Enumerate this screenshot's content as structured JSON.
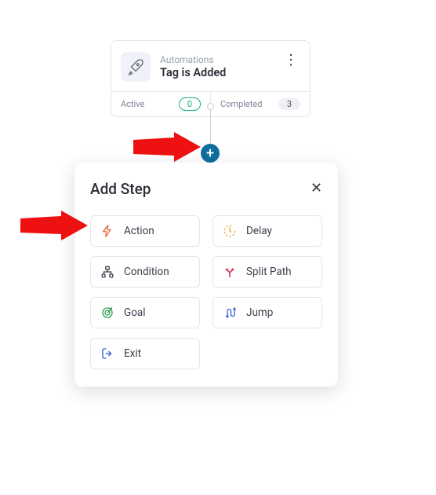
{
  "trigger": {
    "subtitle": "Automations",
    "title": "Tag is Added",
    "icon": "rocket-icon"
  },
  "stats": {
    "active": {
      "label": "Active",
      "value": "0"
    },
    "completed": {
      "label": "Completed",
      "value": "3"
    }
  },
  "plus_button": {
    "icon": "plus-icon"
  },
  "modal": {
    "title": "Add Step",
    "options": [
      {
        "key": "action",
        "label": "Action",
        "icon": "bolt-icon",
        "color": "#e86a3c"
      },
      {
        "key": "delay",
        "label": "Delay",
        "icon": "clock-icon",
        "color": "#f1a23c"
      },
      {
        "key": "condition",
        "label": "Condition",
        "icon": "sitemap-icon",
        "color": "#3a3f4a"
      },
      {
        "key": "split_path",
        "label": "Split Path",
        "icon": "split-icon",
        "color": "#d42a4e"
      },
      {
        "key": "goal",
        "label": "Goal",
        "icon": "target-icon",
        "color": "#2fa04f"
      },
      {
        "key": "jump",
        "label": "Jump",
        "icon": "jump-icon",
        "color": "#3a5fd9"
      },
      {
        "key": "exit",
        "label": "Exit",
        "icon": "exit-icon",
        "color": "#3a5fd9"
      }
    ]
  },
  "annotations": {
    "arrow1": "points to plus button",
    "arrow2": "points to Action option"
  }
}
